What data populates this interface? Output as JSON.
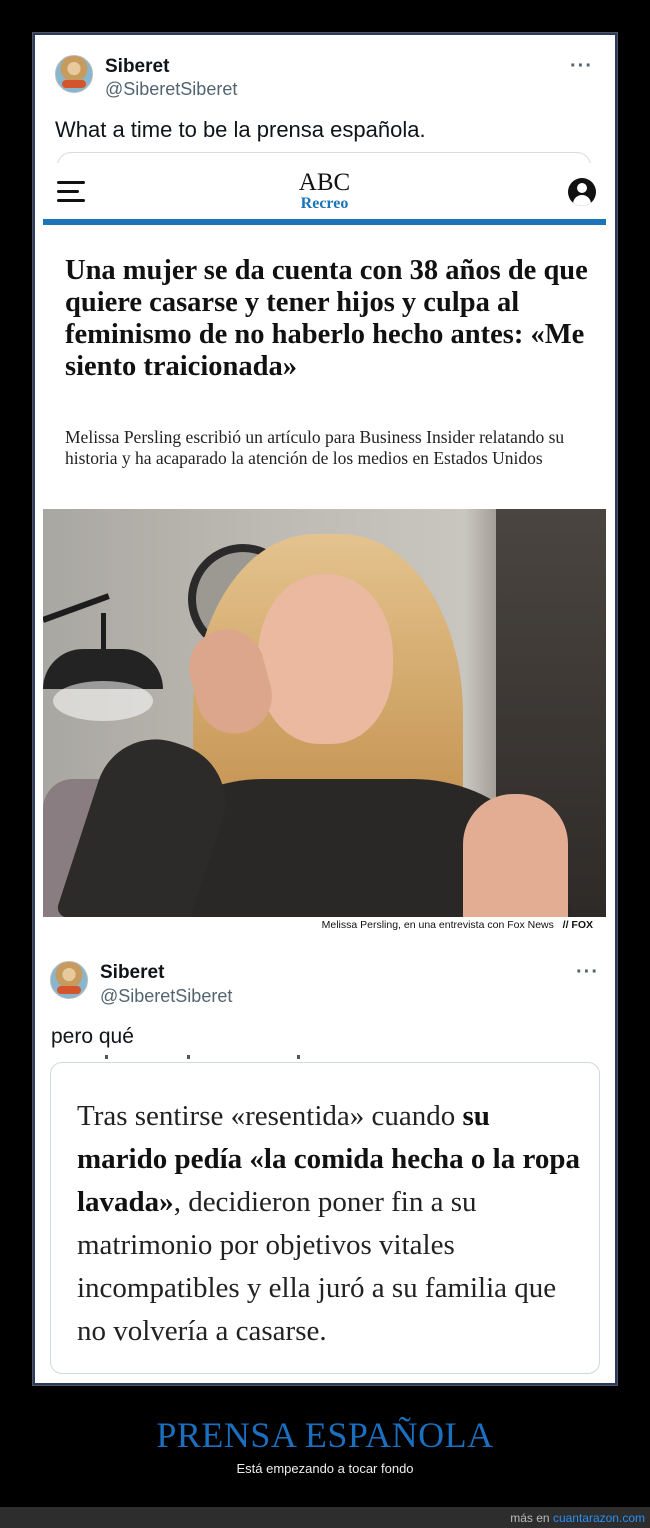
{
  "tweet1": {
    "name": "Siberet",
    "handle": "@SiberetSiberet",
    "more": "···",
    "text": "What a time to be la prensa española."
  },
  "article": {
    "logo": "ABC",
    "section": "Recreo",
    "headline": "Una mujer se da cuenta con 38 años de que quiere casarse y tener hijos y culpa al feminismo de no haberlo hecho antes: «Me siento traicionada»",
    "subhead": "Melissa Persling escribió un artículo para Business Insider relatando su historia y ha acaparado la atención de los medios en Estados Unidos",
    "caption": "Melissa Persling, en una entrevista con Fox News",
    "caption_credit": "// FOX",
    "accent_color": "#1a75b9"
  },
  "tweet2": {
    "name": "Siberet",
    "handle": "@SiberetSiberet",
    "more": "···",
    "text": "pero qué",
    "quote_part1": "Tras sentirse «resentida» cuando ",
    "quote_bold": "su marido pedía «la comida hecha o la ropa lavada»",
    "quote_part2": ", decidieron poner fin a su matrimonio por objetivos vitales incompatibles y ella juró a su familia que no volvería a casarse."
  },
  "footer": {
    "title": "PRENSA ESPAÑOLA",
    "subtitle": "Está empezando a tocar fondo",
    "more_prefix": "más en ",
    "site": "cuantarazon.com",
    "title_color": "#1a6fc0"
  }
}
